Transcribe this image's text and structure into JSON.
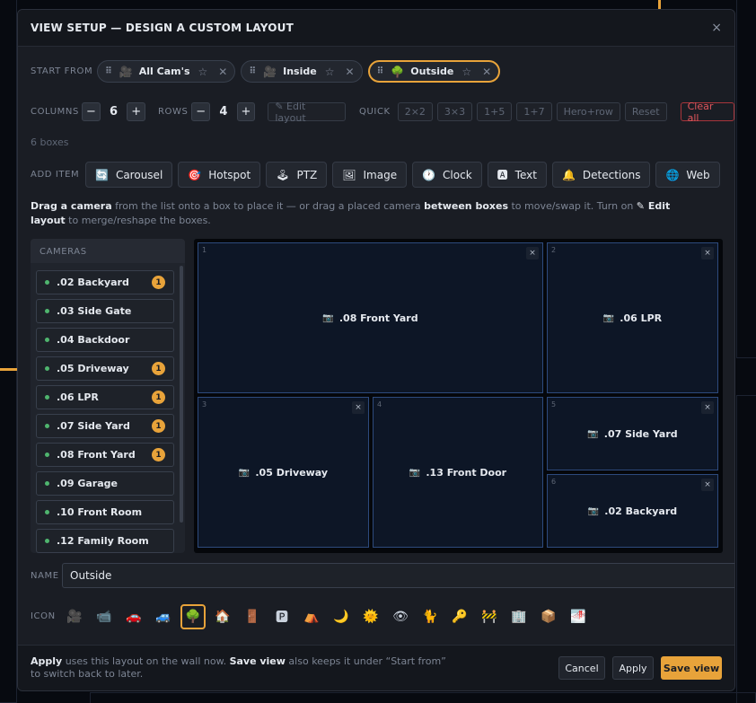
{
  "header": {
    "title": "VIEW SETUP — DESIGN A CUSTOM LAYOUT",
    "close": "×"
  },
  "start_from": {
    "label": "START FROM",
    "presets": [
      {
        "label": "All Cam's",
        "icon": "🎥",
        "active": false
      },
      {
        "label": "Inside",
        "icon": "🎥",
        "active": false
      },
      {
        "label": "Outside",
        "icon": "🌳",
        "active": true
      }
    ]
  },
  "controls": {
    "columns_label": "COLUMNS",
    "columns": "6",
    "rows_label": "ROWS",
    "rows": "4",
    "minus": "−",
    "plus": "+",
    "edit_layout": "✎ Edit layout",
    "quick_label": "QUICK",
    "quick": [
      "2×2",
      "3×3",
      "1+5",
      "1+7",
      "Hero+row",
      "Reset"
    ],
    "clear_all": "Clear all",
    "box_count": "6 boxes"
  },
  "add_item": {
    "label": "ADD ITEM",
    "items": [
      {
        "label": "Carousel",
        "icon": "🔄"
      },
      {
        "label": "Hotspot",
        "icon": "🎯"
      },
      {
        "label": "PTZ",
        "icon": "🕹"
      },
      {
        "label": "Image",
        "icon": "🖼"
      },
      {
        "label": "Clock",
        "icon": "🕐"
      },
      {
        "label": "Text",
        "icon": "🅰"
      },
      {
        "label": "Detections",
        "icon": "🔔"
      },
      {
        "label": "Web",
        "icon": "🌐"
      }
    ]
  },
  "help": {
    "a": "Drag a camera",
    "b": " from the list onto a box to place it — or drag a placed camera ",
    "c": "between boxes",
    "d": " to move/swap it. Turn on ",
    "e": "✎ Edit layout",
    "f": " to merge/reshape the boxes."
  },
  "cameras": {
    "label": "CAMERAS",
    "items": [
      {
        "name": ".02 Backyard",
        "count": "1"
      },
      {
        "name": ".03 Side Gate",
        "count": ""
      },
      {
        "name": ".04 Backdoor",
        "count": ""
      },
      {
        "name": ".05 Driveway",
        "count": "1"
      },
      {
        "name": ".06 LPR",
        "count": "1"
      },
      {
        "name": ".07 Side Yard",
        "count": "1"
      },
      {
        "name": ".08 Front Yard",
        "count": "1"
      },
      {
        "name": ".09 Garage",
        "count": ""
      },
      {
        "name": ".10 Front Room",
        "count": ""
      },
      {
        "name": ".12 Family Room",
        "count": ""
      }
    ]
  },
  "grid": {
    "boxes": [
      {
        "num": "1",
        "camera": ".08 Front Yard"
      },
      {
        "num": "2",
        "camera": ".06 LPR"
      },
      {
        "num": "3",
        "camera": ".05 Driveway"
      },
      {
        "num": "4",
        "camera": ".13 Front Door"
      },
      {
        "num": "5",
        "camera": ".07 Side Yard"
      },
      {
        "num": "6",
        "camera": ".02 Backyard"
      }
    ],
    "remove": "×",
    "camera_icon": "📷"
  },
  "name": {
    "label": "NAME",
    "value": "Outside"
  },
  "icon_picker": {
    "label": "ICON",
    "icons": [
      "🎥",
      "📹",
      "🚗",
      "🚙",
      "🌳",
      "🏠",
      "🚪",
      "🅿",
      "⛺",
      "🌙",
      "🌞",
      "👁",
      "🐈",
      "🔑",
      "🚧",
      "🏢",
      "📦",
      "🌁"
    ],
    "selected": 4
  },
  "footer": {
    "a": "Apply",
    "b": " uses this layout on the wall now. ",
    "c": "Save view",
    "d": " also keeps it under “Start from” to switch back to later.",
    "cancel": "Cancel",
    "apply": "Apply",
    "save": "Save view"
  }
}
